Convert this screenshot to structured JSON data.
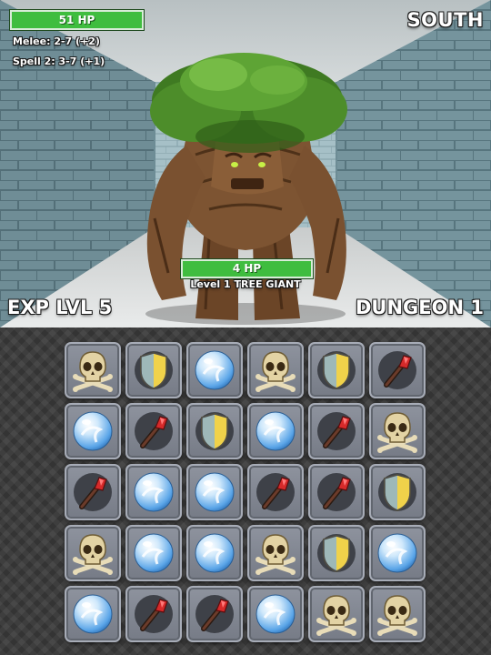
{
  "hud": {
    "player_hp": "51 HP",
    "melee": "Melee: 2-7 (+2)",
    "spell": "Spell 2: 3-7 (+1)",
    "direction": "SOUTH",
    "exp_level": "EXP LVL 5",
    "dungeon": "DUNGEON 1"
  },
  "monster": {
    "hp": "4 HP",
    "name": "Level 1 TREE GIANT"
  },
  "board": {
    "rows": [
      [
        "skull",
        "shield",
        "orb",
        "skull",
        "shield",
        "wand"
      ],
      [
        "orb",
        "wand",
        "shield",
        "orb",
        "wand",
        "skull"
      ],
      [
        "wand",
        "orb",
        "orb",
        "wand",
        "wand",
        "shield"
      ],
      [
        "skull",
        "orb",
        "orb",
        "skull",
        "shield",
        "orb"
      ],
      [
        "orb",
        "wand",
        "wand",
        "orb",
        "skull",
        "skull"
      ]
    ]
  },
  "colors": {
    "hp_bar": "#3fbd3f",
    "wall": "#7fa3ad",
    "tile": "#868b96"
  }
}
